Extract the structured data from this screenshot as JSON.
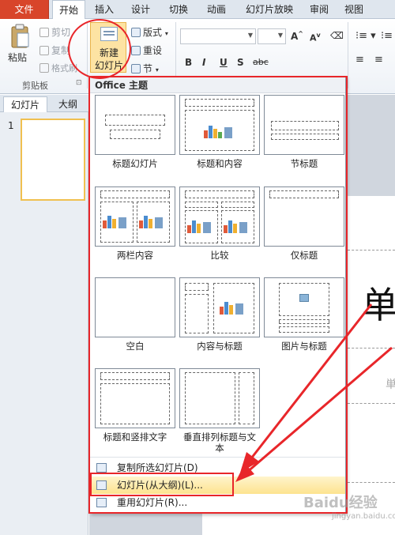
{
  "menu": {
    "tabs": [
      "文件",
      "开始",
      "插入",
      "设计",
      "切换",
      "动画",
      "幻灯片放映",
      "审阅",
      "视图"
    ]
  },
  "clipboard": {
    "paste": "粘贴",
    "cut": "剪切",
    "copy": "复制",
    "format_painter": "格式刷",
    "group_label": "剪贴板"
  },
  "slides_group": {
    "new_slide_line1": "新建",
    "new_slide_line2": "幻灯片",
    "layout": "版式",
    "reset": "重设",
    "section": "节"
  },
  "font_group": {
    "bold": "B",
    "italic": "I",
    "underline": "U",
    "strike": "S",
    "shadow": "abc",
    "grow": "A",
    "shrink": "A"
  },
  "left_pane": {
    "tab_slides": "幻灯片",
    "tab_outline": "大纲",
    "slide_number": "1"
  },
  "slide": {
    "title_char": "单"
  },
  "dropdown": {
    "header": "Office 主题",
    "layouts": [
      {
        "label": "标题幻灯片"
      },
      {
        "label": "标题和内容"
      },
      {
        "label": "节标题"
      },
      {
        "label": "两栏内容"
      },
      {
        "label": "比较"
      },
      {
        "label": "仅标题"
      },
      {
        "label": "空白"
      },
      {
        "label": "内容与标题"
      },
      {
        "label": "图片与标题"
      },
      {
        "label": "标题和竖排文字"
      },
      {
        "label": "垂直排列标题与文本"
      }
    ],
    "items": {
      "duplicate": "复制所选幻灯片(D)",
      "from_outline": "幻灯片(从大纲)(L)...",
      "reuse": "重用幻灯片(R)..."
    }
  },
  "watermark": {
    "main": "Baidu经验",
    "sub": "jingyan.baidu.com"
  },
  "colors": {
    "accent_file": "#d8452a",
    "annotation_red": "#e8262a",
    "hover": "#fde38f"
  }
}
